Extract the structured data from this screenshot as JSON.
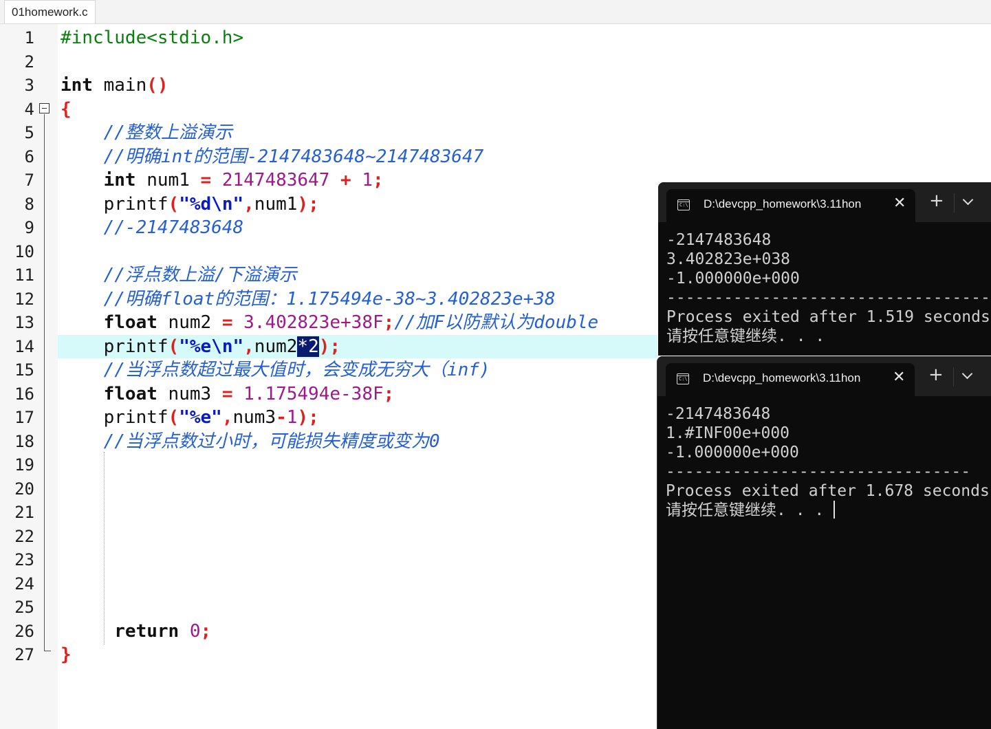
{
  "editor": {
    "tab_label": "01homework.c",
    "line_numbers": [
      "1",
      "2",
      "3",
      "4",
      "5",
      "6",
      "7",
      "8",
      "9",
      "10",
      "11",
      "12",
      "13",
      "14",
      "15",
      "16",
      "17",
      "18",
      "19",
      "20",
      "21",
      "22",
      "23",
      "24",
      "25",
      "26",
      "27"
    ],
    "code": {
      "l1": "#include<stdio.h>",
      "l3_kw": "int",
      "l3_fn": " main",
      "l3_p": "()",
      "l4": "{",
      "l5": "//整数上溢演示",
      "l6": "//明确int的范围-2147483648~2147483647",
      "l7_kw": "int",
      "l7_id": " num1 ",
      "l7_eq": "=",
      "l7_n1": " 2147483647 ",
      "l7_plus": "+",
      "l7_n2": " 1",
      "l7_semi": ";",
      "l8_fn": "printf",
      "l8_p1": "(",
      "l8_s1": "\"",
      "l8_fmt": "%d\\n",
      "l8_s2": "\"",
      "l8_comma": ",",
      "l8_id": "num1",
      "l8_end": ");",
      "l9": "//-2147483648",
      "l11": "//浮点数上溢/下溢演示",
      "l12": "//明确float的范围：1.175494e-38~3.402823e+38",
      "l13_kw": "float",
      "l13_id": " num2 ",
      "l13_eq": "=",
      "l13_n": " 3.402823e+38F",
      "l13_semi": ";",
      "l13_cmt": "//加F以防默认为double",
      "l14_fn": "printf",
      "l14_p1": "(",
      "l14_s1": "\"",
      "l14_fmt": "%e\\n",
      "l14_s2": "\"",
      "l14_comma": ",",
      "l14_id": "num2",
      "l14_sel": "*2",
      "l14_end": ");",
      "l15": "//当浮点数超过最大值时，会变成无穷大（inf)",
      "l16_kw": "float",
      "l16_id": " num3 ",
      "l16_eq": "=",
      "l16_n": " 1.175494e-38F",
      "l16_semi": ";",
      "l17_fn": "printf",
      "l17_p1": "(",
      "l17_s1": "\"",
      "l17_fmt": "%e",
      "l17_s2": "\"",
      "l17_comma": ",",
      "l17_id": "num3",
      "l17_minus": "-",
      "l17_n": "1",
      "l17_end": ");",
      "l18": "//当浮点数过小时，可能损失精度或变为0",
      "l26_kw": "return",
      "l26_n": " 0",
      "l26_semi": ";",
      "l27": "}"
    }
  },
  "terminal1": {
    "title": "D:\\devcpp_homework\\3.11hon",
    "icon": "cmd-icon",
    "lines": [
      "-2147483648",
      "3.402823e+038",
      "-1.000000e+000",
      "----------------------------------",
      "Process exited after 1.519 seconds",
      "请按任意键继续. . ."
    ]
  },
  "terminal2": {
    "title": "D:\\devcpp_homework\\3.11hon",
    "icon": "cmd-icon",
    "lines": [
      "-2147483648",
      "1.#INF00e+000",
      "-1.000000e+000",
      "--------------------------------",
      "Process exited after 1.678 seconds",
      "请按任意键继续. . ."
    ]
  }
}
